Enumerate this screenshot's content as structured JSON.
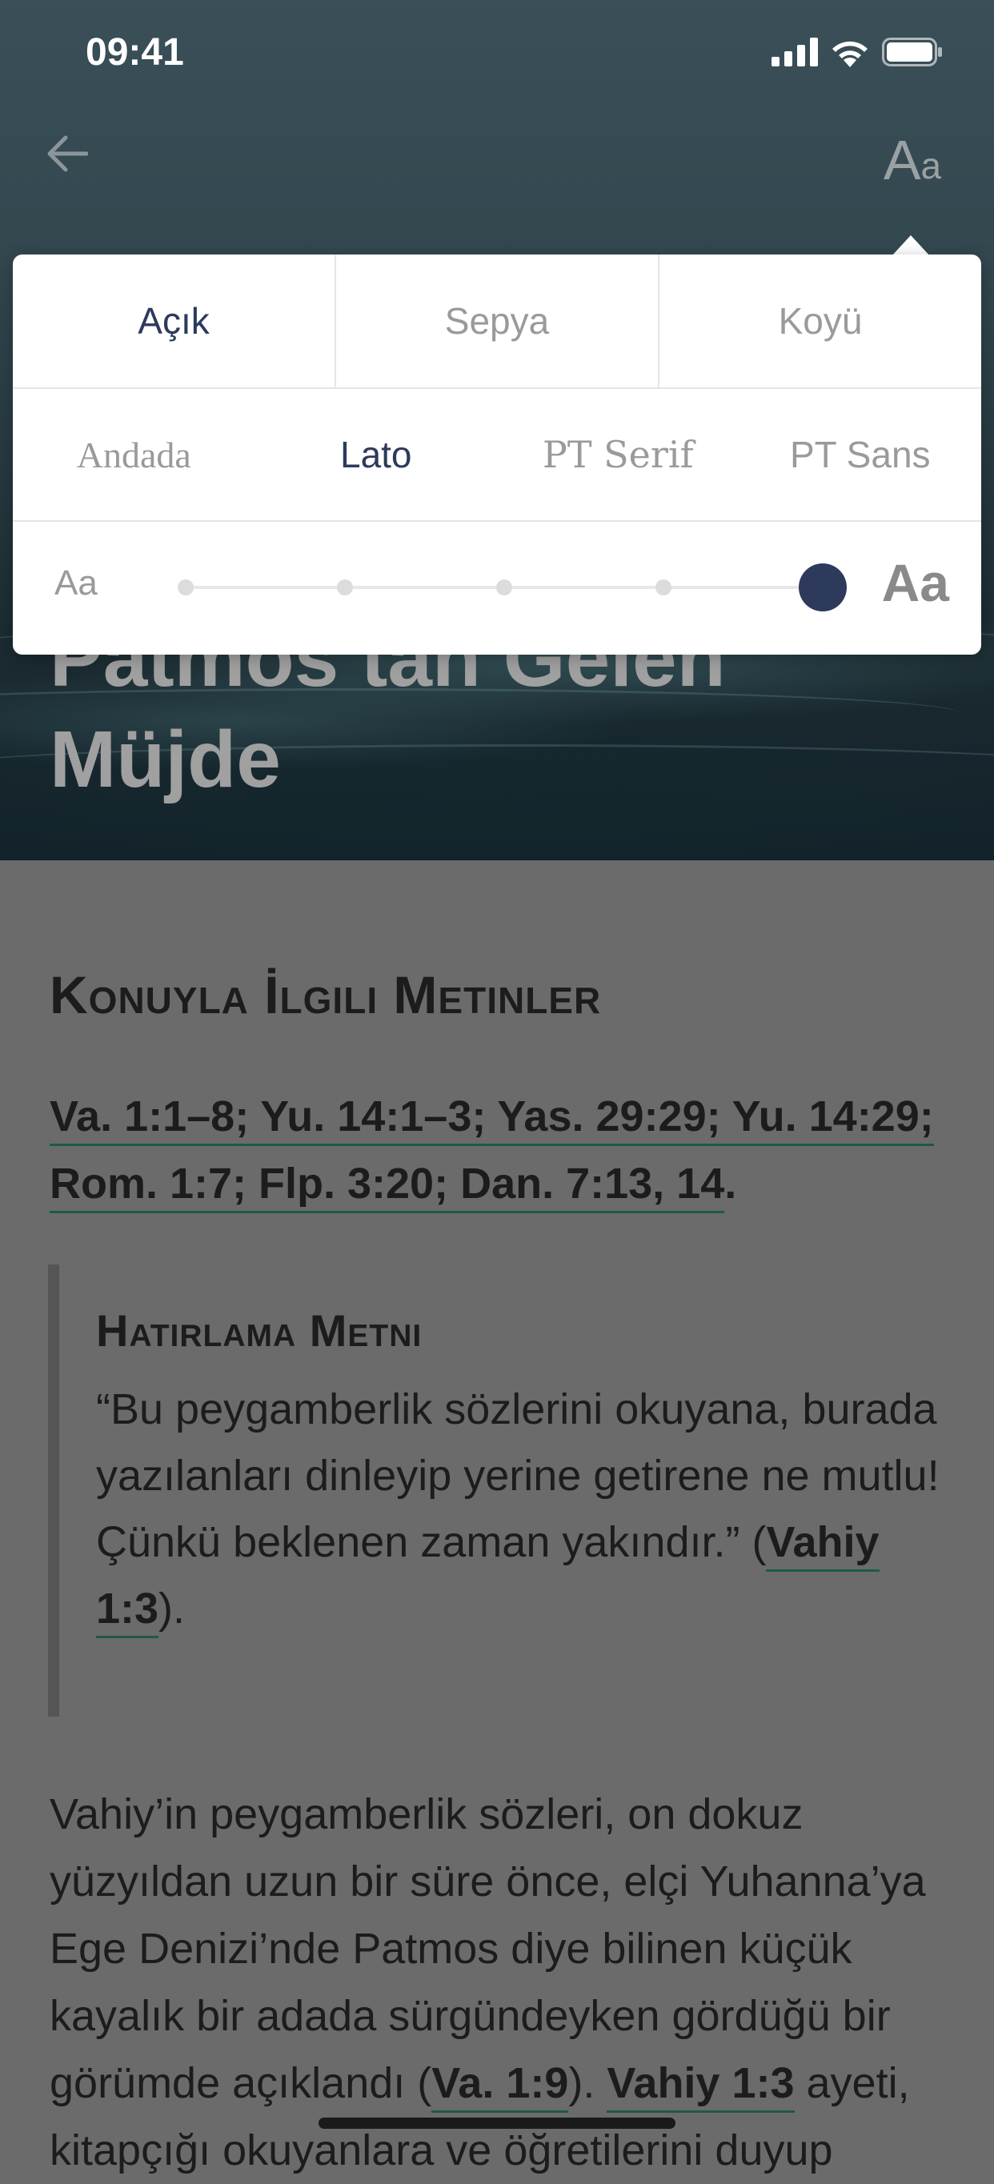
{
  "status_bar": {
    "time": "09:41",
    "icons": [
      "cellular-signal-icon",
      "wifi-icon",
      "battery-icon"
    ]
  },
  "header": {
    "back_icon": "back-arrow-icon",
    "font_button_big": "A",
    "font_button_small": "a"
  },
  "hero": {
    "title_line1": "Patmos’tan Gelen",
    "title_line2": "Müjde"
  },
  "settings": {
    "themes": [
      {
        "label": "Açık",
        "active": true
      },
      {
        "label": "Sepya",
        "active": false
      },
      {
        "label": "Koyü",
        "active": false
      }
    ],
    "fonts": [
      {
        "label": "Andada",
        "active": false
      },
      {
        "label": "Lato",
        "active": true
      },
      {
        "label": "PT Serif",
        "active": false
      },
      {
        "label": "PT Sans",
        "active": false
      }
    ],
    "size_small_label": "Aa",
    "size_big_label": "Aa",
    "size_steps": 5,
    "size_selected_index": 4
  },
  "content": {
    "heading": "Konuyla İlgili Metinler",
    "refs_line1": "Va. 1:1–8; Yu. 14:1–3; Yas. 29:29; Yu. 14:29;",
    "refs_line2": "Rom. 1:7; Flp. 3:20; Dan. 7:13, 14",
    "refs_period": ".",
    "memory": {
      "title": "Hatırlama Metni",
      "text": "“Bu peygamberlik sözlerini okuyana, burada yazılanları dinleyip yerine getirene ne mutlu! Çünkü beklenen zaman yakındır.” (",
      "ref": "Vahiy 1:3",
      "tail": ")."
    },
    "paragraph": {
      "text1": "Vahiy’in peygamberlik sözleri, on dokuz yüzyıldan uzun bir süre önce, elçi Yuhanna’ya Ege Denizi’nde Patmos diye bilinen küçük kayalık bir adada sürgündeyken gördüğü bir görümde açıklandı (",
      "ref1": "Va. 1:9",
      "text2": "). ",
      "ref2": "Vahiy 1:3",
      "text3": " ayeti, kitapçığı okuyanlara ve öğretilerini duyup"
    }
  },
  "colors": {
    "accent": "#2d3a5c",
    "link_underline": "#1e5a44",
    "overlay_gray": "#6b6b6b"
  }
}
